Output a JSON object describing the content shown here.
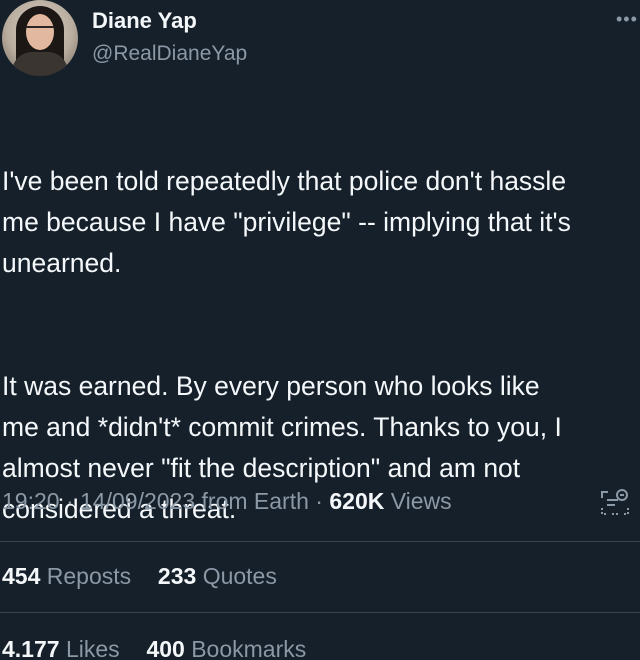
{
  "author": {
    "display_name": "Diane Yap",
    "handle": "@RealDianeYap"
  },
  "tweet": {
    "paragraph_1": "I've been told repeatedly that police don't hassle\nme because I have \"privilege\" -- implying that it's\nunearned.",
    "paragraph_2": "It was earned. By every person who looks like\nme and *didn't* commit crimes. Thanks to you, I\nalmost never \"fit the description\" and am not\nconsidered a threat."
  },
  "meta": {
    "time": "19:20",
    "separator": "·",
    "date": "14/09/2023",
    "source": "from Earth",
    "views_count": "620K",
    "views_label": "Views"
  },
  "stats": {
    "reposts_count": "454",
    "reposts_label": "Reposts",
    "quotes_count": "233",
    "quotes_label": "Quotes",
    "likes_count": "4.177",
    "likes_label": "Likes",
    "bookmarks_count": "400",
    "bookmarks_label": "Bookmarks"
  },
  "icons": {
    "more": "more-horizontal-icon",
    "summary": "post-summary-icon"
  },
  "colors": {
    "background": "#15202b",
    "text_primary": "#f5f8fa",
    "text_secondary": "#8b98a5",
    "divider": "#38444d"
  }
}
